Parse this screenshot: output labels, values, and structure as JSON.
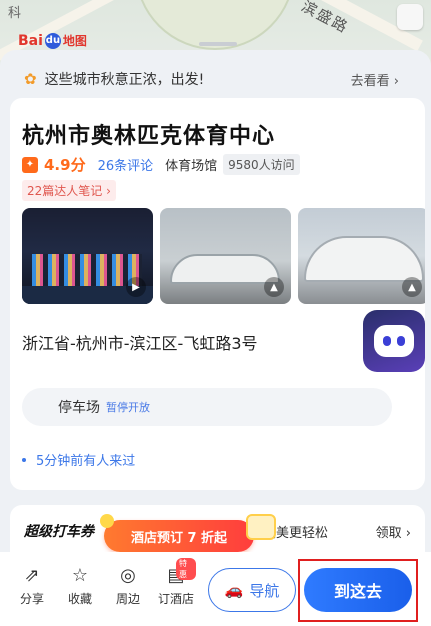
{
  "map": {
    "logo_text": "Bai",
    "logo_paw": "du",
    "logo_tail": "地图",
    "street_label": "滨盛路",
    "road_label": "科"
  },
  "banner": {
    "text": "这些城市秋意正浓，出发!",
    "link": "去看看 ›"
  },
  "place": {
    "title": "杭州市奥林匹克体育中心",
    "rating": "4.9分",
    "reviews": "26条评论",
    "category": "体育场馆",
    "visits": "9580人访问",
    "notes": "22篇达人笔记 ›",
    "address": "浙江省-杭州市-滨江区-飞虹路3号",
    "parking_label": "停车场",
    "parking_status": "暂停开放",
    "recent": "5分钟前有人来过"
  },
  "promo": {
    "left": "超级打车券",
    "mid": "乐变美更轻松",
    "right": "领取 ›",
    "hotel_tag": "酒店预订 7 折起"
  },
  "actions": [
    {
      "label": "分享",
      "icon": "share-icon"
    },
    {
      "label": "收藏",
      "icon": "star-icon"
    },
    {
      "label": "周边",
      "icon": "compass-icon"
    },
    {
      "label": "订酒店",
      "icon": "hotel-icon",
      "badge": "特惠"
    }
  ],
  "buttons": {
    "navigate": "导航",
    "go_here": "到这去"
  },
  "colors": {
    "accent": "#3c77e8",
    "rating": "#ff6a1b",
    "highlight": "#e01f1f"
  }
}
